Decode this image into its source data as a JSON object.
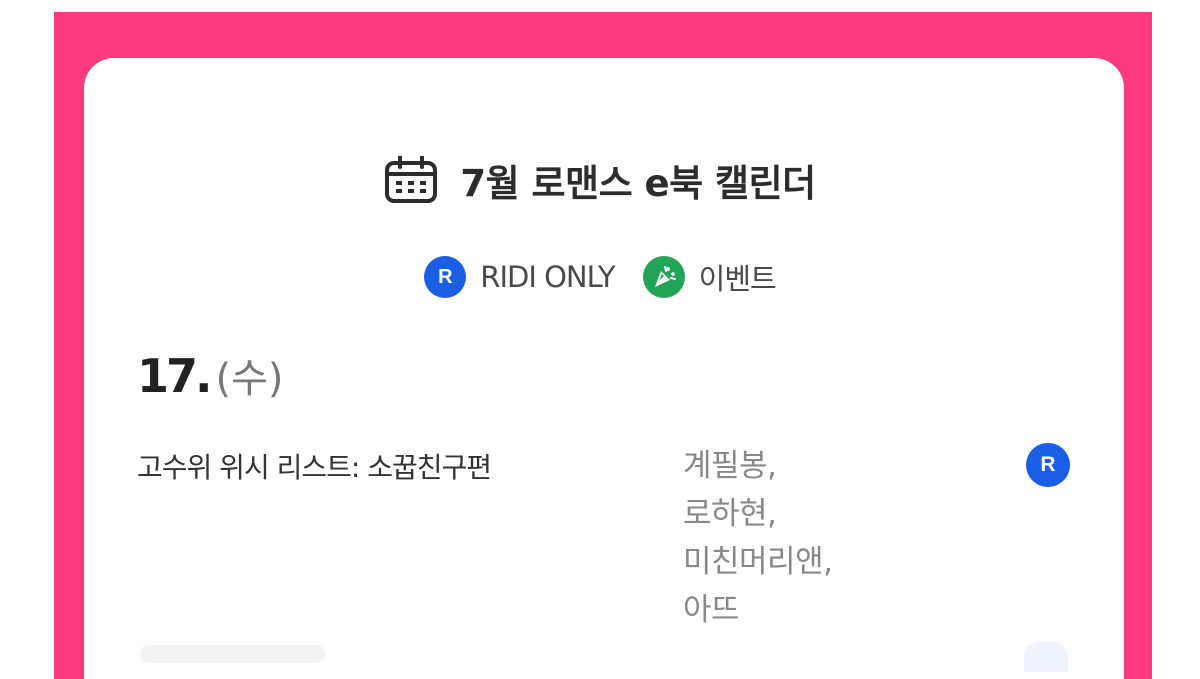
{
  "header": {
    "title": "7월 로맨스 e북 캘린더",
    "title_icon": "calendar-icon"
  },
  "legend": {
    "ridi_only": {
      "badge": "R",
      "label": "RIDI ONLY",
      "icon": "ridi-r-badge-icon",
      "color": "#1a5ee6"
    },
    "event": {
      "label": "이벤트",
      "icon": "party-popper-icon",
      "color": "#22a556"
    }
  },
  "day": {
    "number": "17.",
    "weekday": "(수)"
  },
  "entries": [
    {
      "title": "고수위 위시 리스트: 소꿉친구편",
      "authors": "계필봉, 로하현, 미친머리앤, 아뜨",
      "badge": "R"
    }
  ],
  "colors": {
    "frame": "#fd3a7e",
    "card": "#ffffff",
    "title_text": "#2c2c2c",
    "author_text": "#888888"
  }
}
